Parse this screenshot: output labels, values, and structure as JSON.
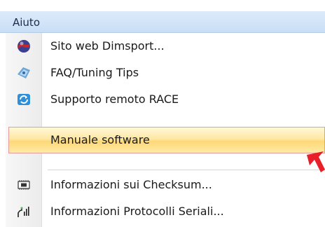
{
  "menu_title": "Aiuto",
  "items": [
    {
      "label": "Sito web Dimsport...",
      "icon": "globe-icon"
    },
    {
      "label": "FAQ/Tuning Tips",
      "icon": "faq-icon"
    },
    {
      "label": "Supporto remoto RACE",
      "icon": "remote-support-icon"
    },
    {
      "label": "Manuale software",
      "icon": ""
    },
    {
      "label": "Informazioni sui Checksum...",
      "icon": "chip-icon"
    },
    {
      "label": "Informazioni Protocolli Seriali...",
      "icon": "serial-signal-icon"
    }
  ],
  "colors": {
    "menubar": "#d4e6fa",
    "highlight": "#fed877",
    "highlight_border": "#e39d9d",
    "arrow": "#e8202a"
  }
}
